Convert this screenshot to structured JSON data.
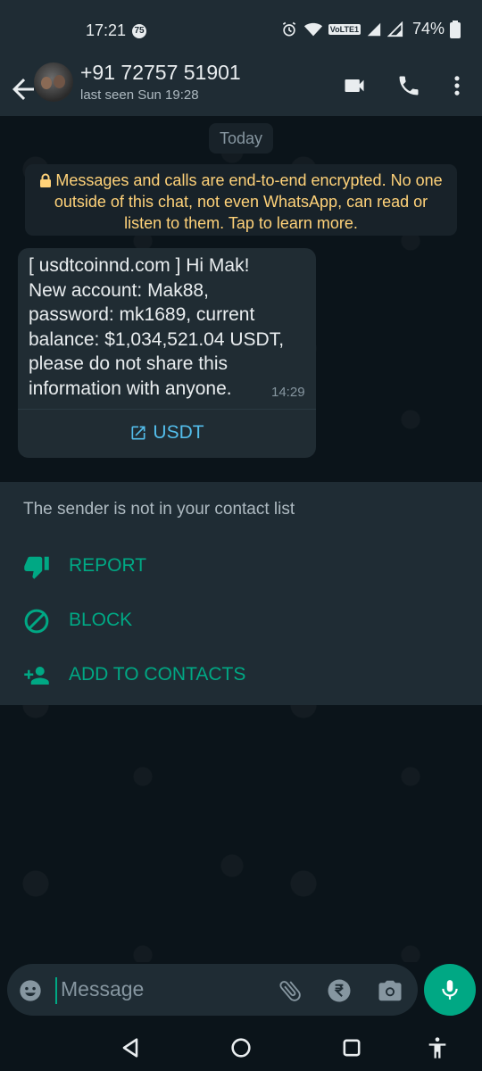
{
  "status_bar": {
    "time": "17:21",
    "notification_badge": "75",
    "network_badge": "VoLTE1",
    "battery": "74%"
  },
  "header": {
    "contact_name": "+91 72757 51901",
    "last_seen": "last seen Sun 19:28",
    "icons": [
      "back-arrow-icon",
      "video-call-icon",
      "phone-icon",
      "more-options-icon"
    ]
  },
  "chat": {
    "date_chip": "Today",
    "encryption_notice": "Messages and calls are end-to-end encrypted. No one outside of this chat, not even WhatsApp, can read or listen to them. Tap to learn more.",
    "message": {
      "text": "[ usdtcoinnd.com ] Hi Mak!\nNew account: Mak88,\npassword: mk1689, current\nbalance: $1,034,521.04 USDT,\nplease do not share this\ninformation with anyone.",
      "time": "14:29",
      "link_button": "USDT"
    }
  },
  "unknown_sender_panel": {
    "notice": "The sender is not in your contact list",
    "actions": [
      {
        "label": "REPORT",
        "icon": "thumbs-down-icon"
      },
      {
        "label": "BLOCK",
        "icon": "block-icon"
      },
      {
        "label": "ADD TO CONTACTS",
        "icon": "add-person-icon"
      }
    ]
  },
  "composer": {
    "placeholder": "Message",
    "icons": [
      "emoji-icon",
      "attach-icon",
      "rupee-icon",
      "camera-icon",
      "mic-icon"
    ]
  },
  "colors": {
    "accent": "#00a884",
    "link": "#53bdeb",
    "notice_yellow": "#ffd279",
    "bubble": "#202c33",
    "background": "#0b141a"
  }
}
